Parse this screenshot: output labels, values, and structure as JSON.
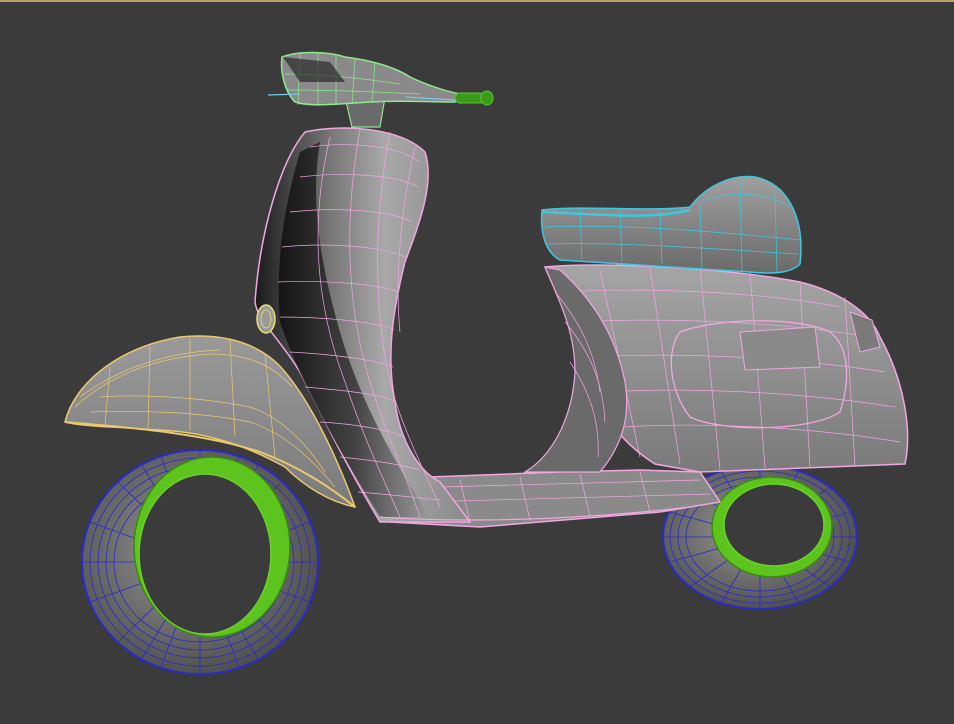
{
  "viewport": {
    "background": "#3b3b3b",
    "active_border": "#b8a46a"
  },
  "model": {
    "object": "scooter",
    "wire_colors": {
      "body": "#f0a8e0",
      "seat": "#3ec8e0",
      "front_fender": "#e8c870",
      "handlebar": "#8ee88e",
      "tires": "#2a2ac8",
      "rims": "#6ad22a",
      "grip": "#3a9a1a",
      "mirror_line": "#7ac8e8"
    },
    "shaded_color": "#8a8a8a"
  }
}
